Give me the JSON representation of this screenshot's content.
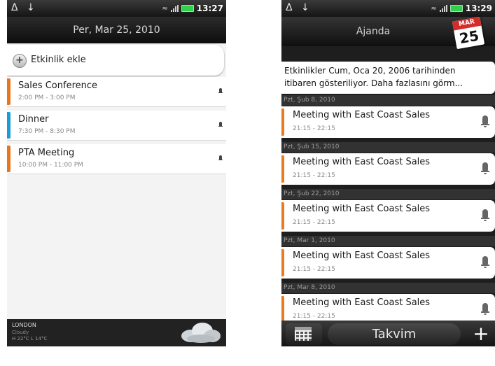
{
  "status_left": {
    "icons": "Δ ↓",
    "clock": "13:27",
    "icon_names": [
      "alert-icon",
      "usb-icon",
      "wifi-icon",
      "signal-icon",
      "battery-icon"
    ]
  },
  "status_right": {
    "icons": "Δ ↓",
    "clock": "13:29"
  },
  "day_view": {
    "date_title": "Per, Mar 25, 2010",
    "add_event_label": "Etkinlik ekle",
    "events": [
      {
        "title": "Sales Conference",
        "time": "2:00 PM - 3:00 PM",
        "color": "#e8761f"
      },
      {
        "title": "Dinner",
        "time": "7:30 PM - 8:30 PM",
        "color": "#1c9cd6"
      },
      {
        "title": "PTA Meeting",
        "time": "10:00 PM - 11:00 PM",
        "color": "#e8761f"
      }
    ],
    "weather": {
      "city": "LONDON",
      "condition": "Cloudy",
      "temps": "H 22°C  L 14°C"
    }
  },
  "agenda_view": {
    "title": "Ajanda",
    "cal_icon_month": "MAR",
    "cal_icon_day": "25",
    "info_line1": "Etkinlikler Cum, Oca 20, 2006 tarihinden",
    "info_line2": "itibaren gösteriliyor. Daha fazlasını görm...",
    "groups": [
      {
        "date": "Pzt, Şub 8, 2010",
        "title": "Meeting with East Coast Sales",
        "time": "21:15 - 22:15"
      },
      {
        "date": "Pzt, Şub 15, 2010",
        "title": "Meeting with East Coast Sales",
        "time": "21:15 - 22:15"
      },
      {
        "date": "Pzt, Şub 22, 2010",
        "title": "Meeting with East Coast Sales",
        "time": "21:15 - 22:15"
      },
      {
        "date": "Pzt, Mar 1, 2010",
        "title": "Meeting with East Coast Sales",
        "time": "21:15 - 22:15"
      },
      {
        "date": "Pzt, Mar 8, 2010",
        "title": "Meeting with East Coast Sales",
        "time": "21:15 - 22:15"
      }
    ],
    "bottom_tab": "Takvim",
    "add_button": "+"
  },
  "colors": {
    "accent_orange": "#e8761f",
    "accent_blue": "#1c9cd6",
    "battery_green": "#2fd14a"
  }
}
